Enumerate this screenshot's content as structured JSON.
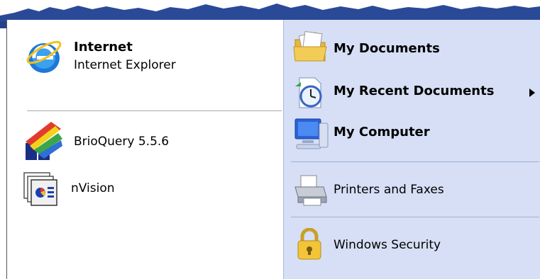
{
  "left": {
    "pinned": {
      "title": "Internet",
      "subtitle": "Internet Explorer"
    },
    "programs": [
      {
        "label": "BrioQuery 5.5.6"
      },
      {
        "label": "nVision"
      }
    ]
  },
  "right": {
    "items": [
      {
        "label": "My Documents",
        "icon": "folder-documents-icon"
      },
      {
        "label": "My Recent Documents",
        "icon": "recent-documents-icon",
        "submenu": true
      },
      {
        "label": "My Computer",
        "icon": "computer-icon"
      },
      {
        "label": "Printers and Faxes",
        "icon": "printer-icon"
      },
      {
        "label": "Windows Security",
        "icon": "padlock-icon"
      }
    ]
  },
  "colors": {
    "banner": "#24428c",
    "left_bg": "#ffffff",
    "right_bg": "#d6dff5"
  }
}
